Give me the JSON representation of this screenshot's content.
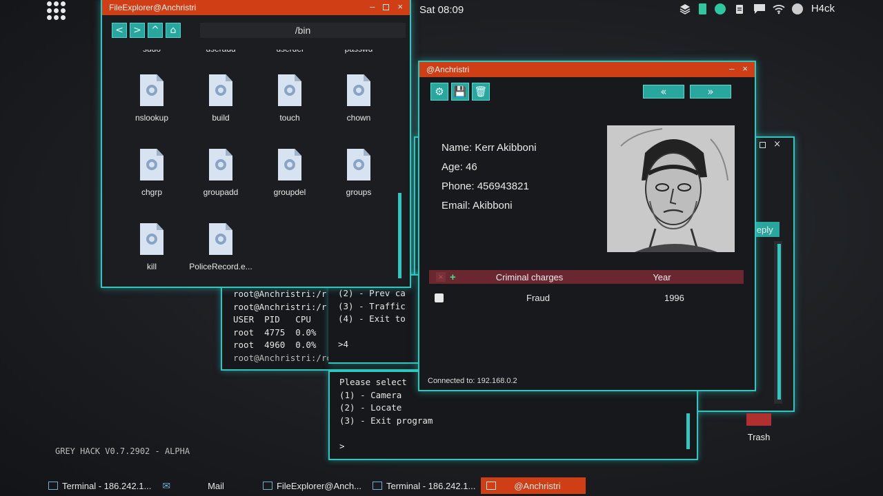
{
  "topbar": {
    "clock": "Sat 08:09",
    "user": "H4ck"
  },
  "file_explorer": {
    "title": "FileExplorer@Anchristri",
    "path": "/bin",
    "partial_row": [
      "sudo",
      "useradd",
      "userdel",
      "passwd"
    ],
    "files": [
      "nslookup",
      "build",
      "touch",
      "chown",
      "chgrp",
      "groupadd",
      "groupdel",
      "groups",
      "kill",
      "PoliceRecord.e..."
    ]
  },
  "terminal_left": {
    "lines": [
      "root@Anchristri:/r",
      "root@Anchristri:/r",
      "USER  PID   CPU",
      "root  4775  0.0%",
      "root  4960  0.0%",
      "root@Anchristri:/root>"
    ]
  },
  "terminal_mid": {
    "lines": [
      "(2) - Prev ca",
      "(3) - Traffic",
      "(4) - Exit to",
      "",
      ">4"
    ]
  },
  "terminal_bottom": {
    "lines": [
      "Please select",
      "(1) - Camera",
      "(2) - Locate",
      "(3) - Exit program",
      "",
      ">"
    ]
  },
  "police_record": {
    "title": "@Anchristri",
    "name": "Name: Kerr Akibboni",
    "age": "Age: 46",
    "phone": "Phone: 456943821",
    "email": "Email: Akibboni",
    "charges_header": "Criminal charges",
    "year_header": "Year",
    "charges": [
      {
        "charge": "Fraud",
        "year": "1996"
      }
    ],
    "status": "Connected to: 192.168.0.2"
  },
  "back_window": {
    "reply": "Reply"
  },
  "desktop": {
    "version": "GREY HACK V0.7.2902 - ALPHA",
    "trash": "Trash"
  },
  "taskbar": [
    {
      "label": "Terminal - 186.242.1..."
    },
    {
      "label": "Mail"
    },
    {
      "label": "FileExplorer@Anch..."
    },
    {
      "label": "Terminal - 186.242.1..."
    },
    {
      "label": "@Anchristri"
    }
  ],
  "colors": {
    "accent": "#2fc7c0",
    "titlebar": "#cf3e14",
    "charges_header": "#6a2730"
  }
}
